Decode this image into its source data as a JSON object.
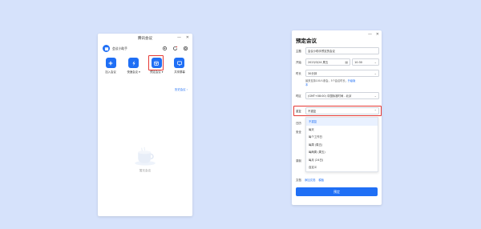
{
  "left_window": {
    "title": "腾讯会议",
    "min": "—",
    "close": "✕",
    "username": "会议小助手",
    "actions": [
      {
        "label": "加入会议",
        "icon": "plus-icon"
      },
      {
        "label": "快速会议 ▾",
        "icon": "lightning-icon"
      },
      {
        "label": "预定会议 ▾",
        "icon": "calendar-icon"
      },
      {
        "label": "共享屏幕",
        "icon": "monitor-icon"
      }
    ],
    "history_link": "历史会议 ›",
    "empty_label": "暂无会议"
  },
  "right_window": {
    "title": "预定会议",
    "min": "—",
    "close": "✕",
    "topic_label": "主题",
    "topic_value": "会议小助手预定的会议",
    "start_label": "开始",
    "start_date": "2023/3/24 周五",
    "start_time": "10:30",
    "duration_label": "时长",
    "duration_value": "30分钟",
    "note_text": "最多支持100人参会，5个会议时长，",
    "note_link": "升级版",
    "note_link2": "本",
    "timezone_label": "时区",
    "timezone_value": "(GMT+08:00) 中国标准时间 - 北京",
    "repeat_label": "重复",
    "repeat_value": "不重复",
    "dropdown_options": [
      "不重复",
      "每天",
      "每个工作日",
      "每周 (周五)",
      "每两周 (周五)",
      "每月 (24日)",
      "自定义"
    ],
    "calendar_label": "日历",
    "security_label": "安全",
    "record_label": "录制",
    "doc_label": "文档",
    "doc_link1": "添加文档",
    "doc_link2": "模板",
    "submit_label": "预定"
  }
}
